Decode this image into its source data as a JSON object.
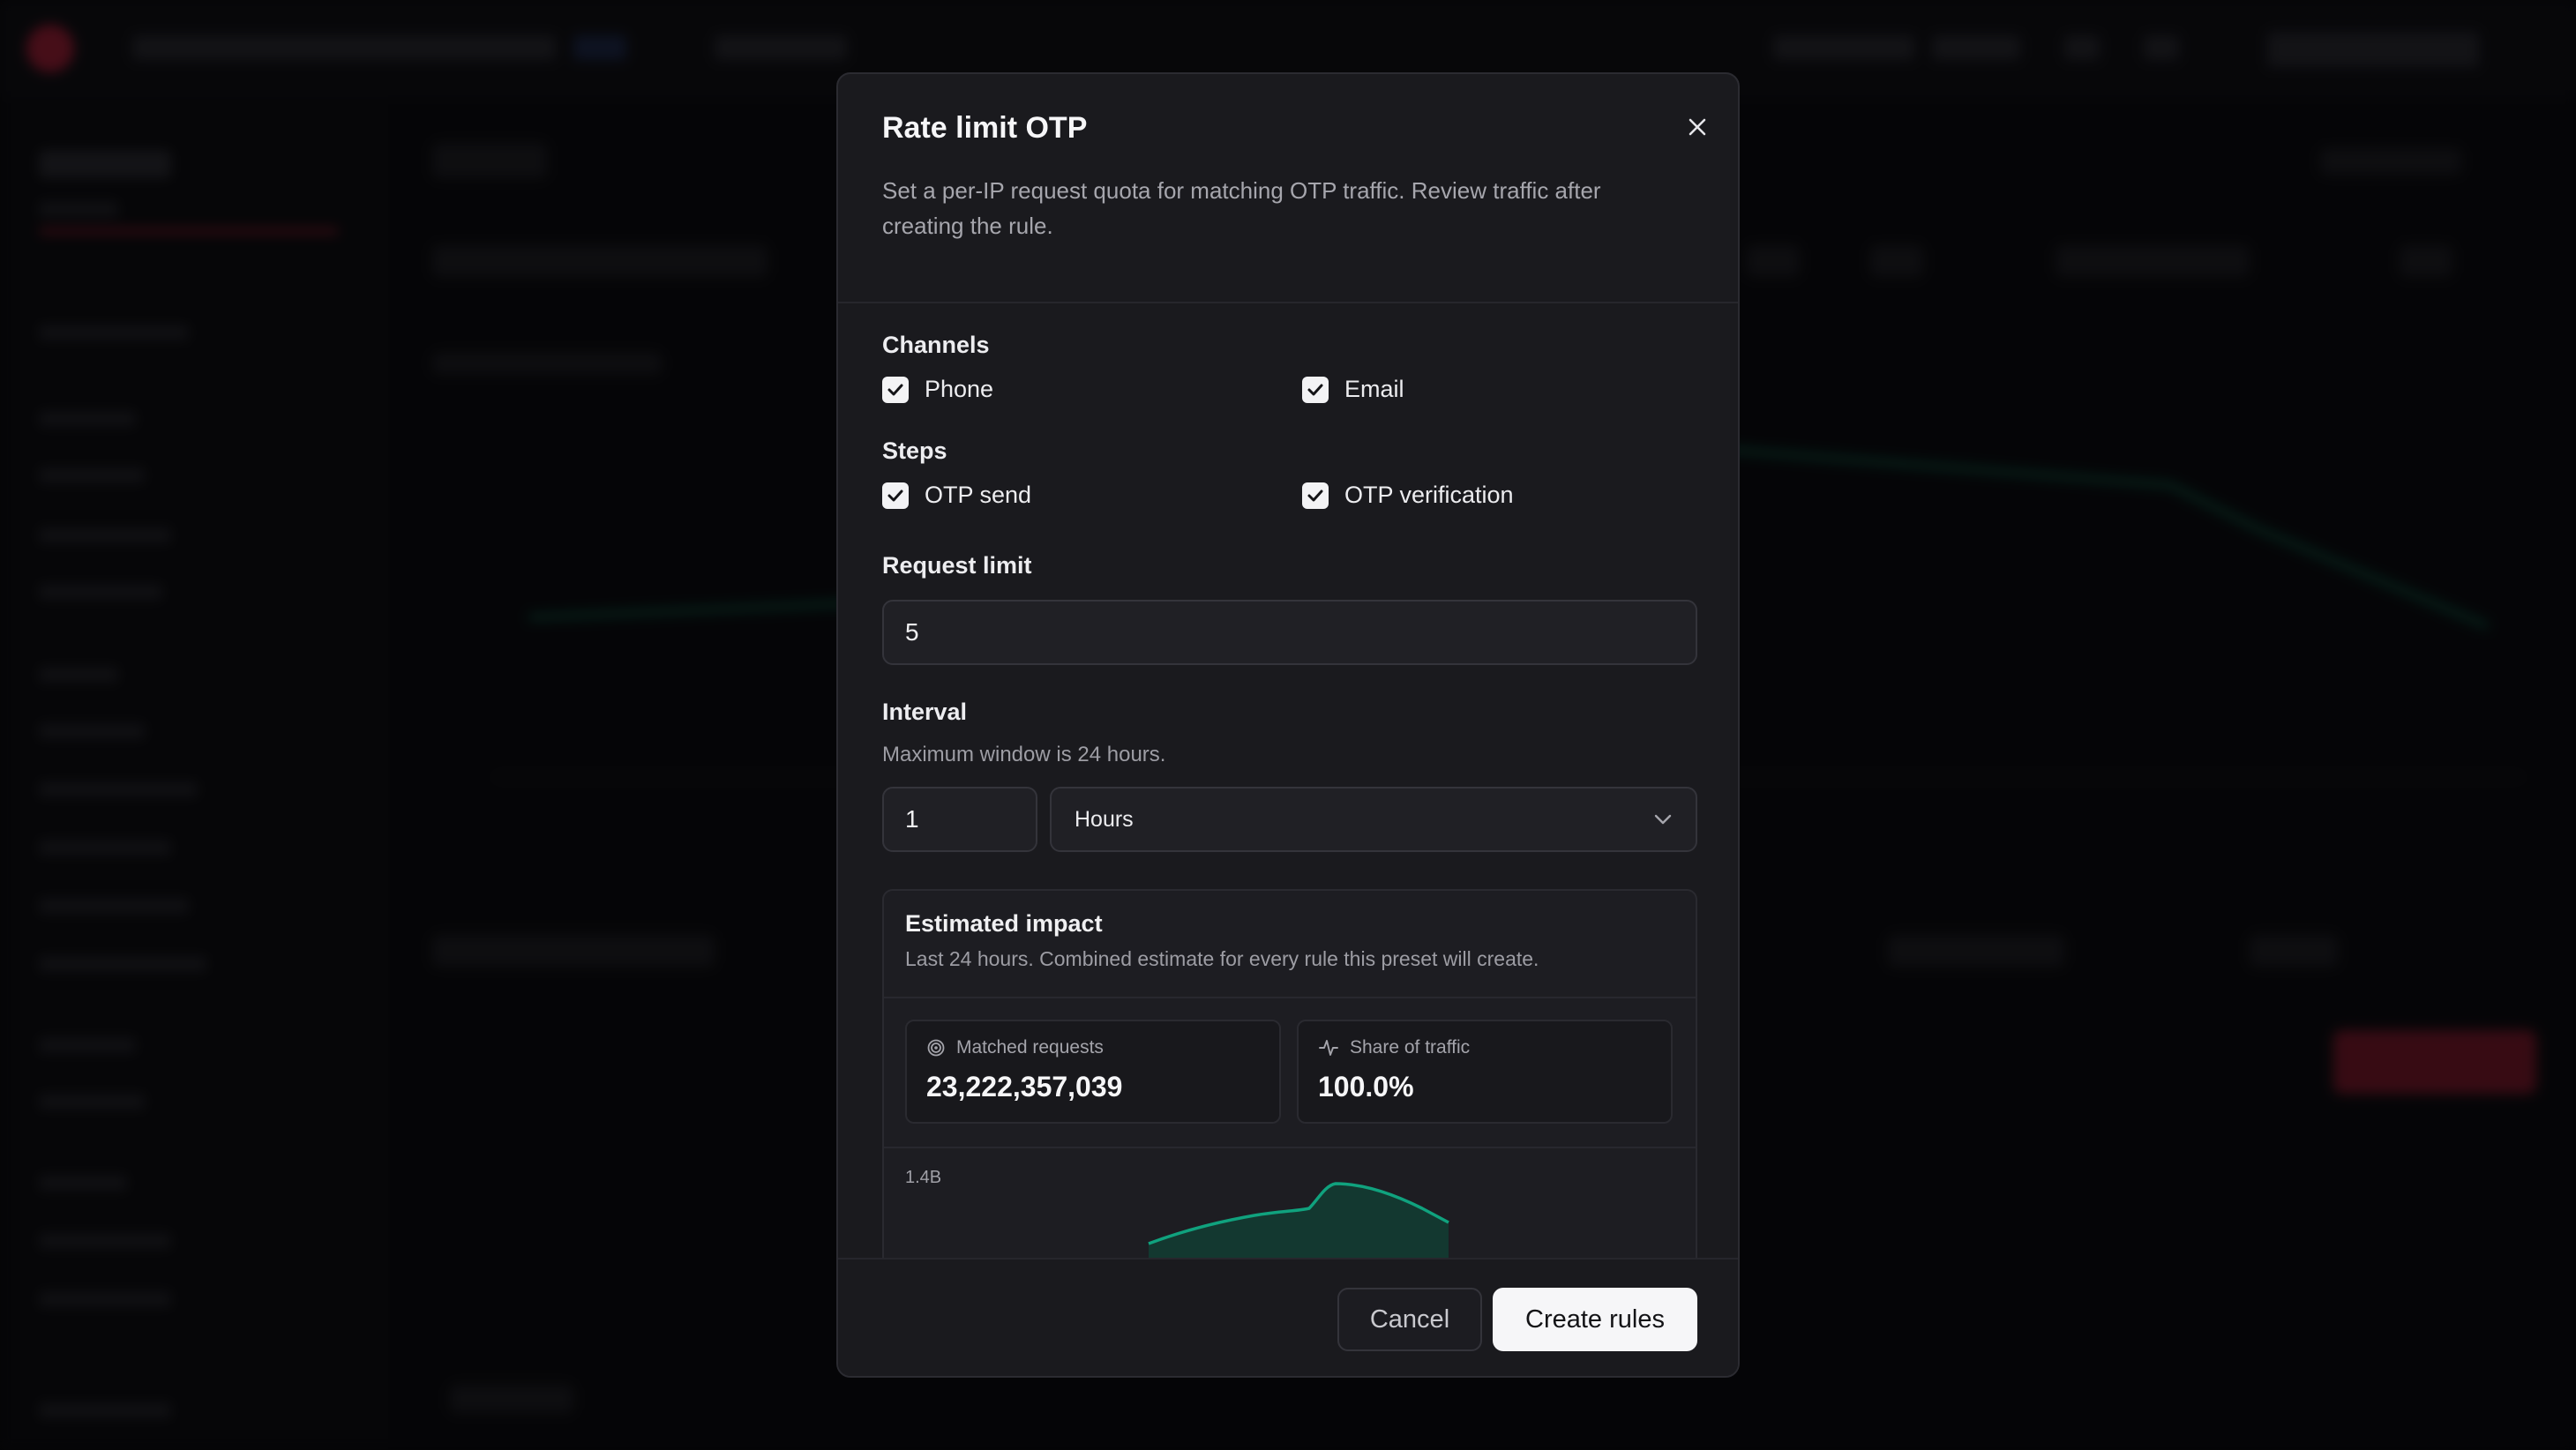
{
  "modal": {
    "title": "Rate limit OTP",
    "description": "Set a per-IP request quota for matching OTP traffic. Review traffic after creating the rule."
  },
  "channels": {
    "label": "Channels",
    "options": [
      {
        "label": "Phone",
        "checked": true
      },
      {
        "label": "Email",
        "checked": true
      }
    ]
  },
  "steps": {
    "label": "Steps",
    "options": [
      {
        "label": "OTP send",
        "checked": true
      },
      {
        "label": "OTP verification",
        "checked": true
      }
    ]
  },
  "request_limit": {
    "label": "Request limit",
    "value": "5"
  },
  "interval": {
    "label": "Interval",
    "hint": "Maximum window is 24 hours.",
    "value": "1",
    "unit": "Hours"
  },
  "impact": {
    "title": "Estimated impact",
    "subtitle": "Last 24 hours. Combined estimate for every rule this preset will create.",
    "metrics": [
      {
        "label": "Matched requests",
        "value": "23,222,357,039",
        "icon": "target-icon"
      },
      {
        "label": "Share of traffic",
        "value": "100.0%",
        "icon": "activity-icon"
      }
    ],
    "chart_y_label": "1.4B"
  },
  "footer": {
    "cancel_label": "Cancel",
    "create_label": "Create rules"
  },
  "colors": {
    "accent_green": "#10a27e",
    "primary_button": "#f6f6f8",
    "modal_bg": "#1a1a1e"
  }
}
